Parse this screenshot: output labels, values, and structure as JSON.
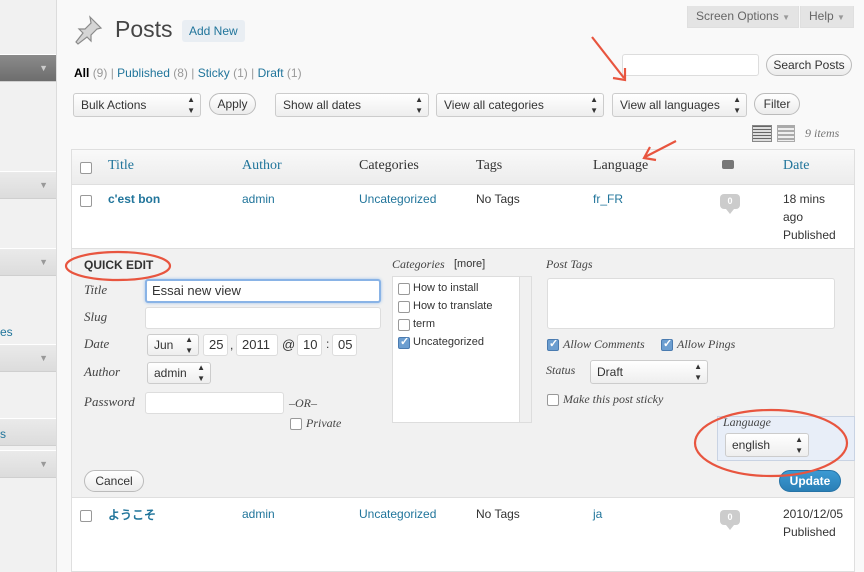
{
  "sidebar": {
    "links": [
      "es",
      "s"
    ]
  },
  "header": {
    "title": "Posts",
    "add_new": "Add New",
    "screen_options": "Screen Options",
    "help": "Help"
  },
  "views": [
    {
      "label": "All",
      "count": "(9)"
    },
    {
      "label": "Published",
      "count": "(8)"
    },
    {
      "label": "Sticky",
      "count": "(1)"
    },
    {
      "label": "Draft",
      "count": "(1)"
    }
  ],
  "views_sep": "|",
  "search": {
    "value": "",
    "button": "Search Posts"
  },
  "filters": {
    "bulk_actions": "Bulk Actions",
    "apply": "Apply",
    "dates": "Show all dates",
    "categories": "View all categories",
    "languages": "View all languages",
    "filter": "Filter",
    "items_count": "9 items"
  },
  "table": {
    "headers": {
      "title": "Title",
      "author": "Author",
      "categories": "Categories",
      "tags": "Tags",
      "language": "Language",
      "date": "Date"
    },
    "rows": [
      {
        "title": "c'est bon",
        "author": "admin",
        "category": "Uncategorized",
        "tags": "No Tags",
        "language": "fr_FR",
        "comments": "0",
        "date_line1": "18 mins",
        "date_line2": "ago",
        "status": "Published"
      },
      {
        "title": "ようこそ",
        "author": "admin",
        "category": "Uncategorized",
        "tags": "No Tags",
        "language": "ja",
        "comments": "0",
        "date_line1": "2010/12/05",
        "status": "Published"
      }
    ]
  },
  "quick_edit": {
    "heading": "QUICK EDIT",
    "title_label": "Title",
    "title_value": "Essai new view",
    "slug_label": "Slug",
    "slug_value": "",
    "date_label": "Date",
    "month": "Jun",
    "day": "25",
    "year": "2011",
    "at": "@",
    "hour": "10",
    "colon": ":",
    "minute": "05",
    "comma": ",",
    "author_label": "Author",
    "author_value": "admin",
    "password_label": "Password",
    "password_value": "",
    "or": "–OR–",
    "private": "Private",
    "categories_label": "Categories",
    "categories_more": "[more]",
    "categories": [
      {
        "label": "How to install",
        "checked": false
      },
      {
        "label": "How to translate",
        "checked": false
      },
      {
        "label": "term",
        "checked": false
      },
      {
        "label": "Uncategorized",
        "checked": true
      }
    ],
    "post_tags_label": "Post Tags",
    "allow_comments": "Allow Comments",
    "allow_pings": "Allow Pings",
    "status_label": "Status",
    "status_value": "Draft",
    "sticky": "Make this post sticky",
    "language_label": "Language",
    "language_value": "english",
    "cancel": "Cancel",
    "update": "Update"
  },
  "colors": {
    "link": "#21759b",
    "annotation": "#e8553f",
    "update": "#2e8fc7"
  }
}
